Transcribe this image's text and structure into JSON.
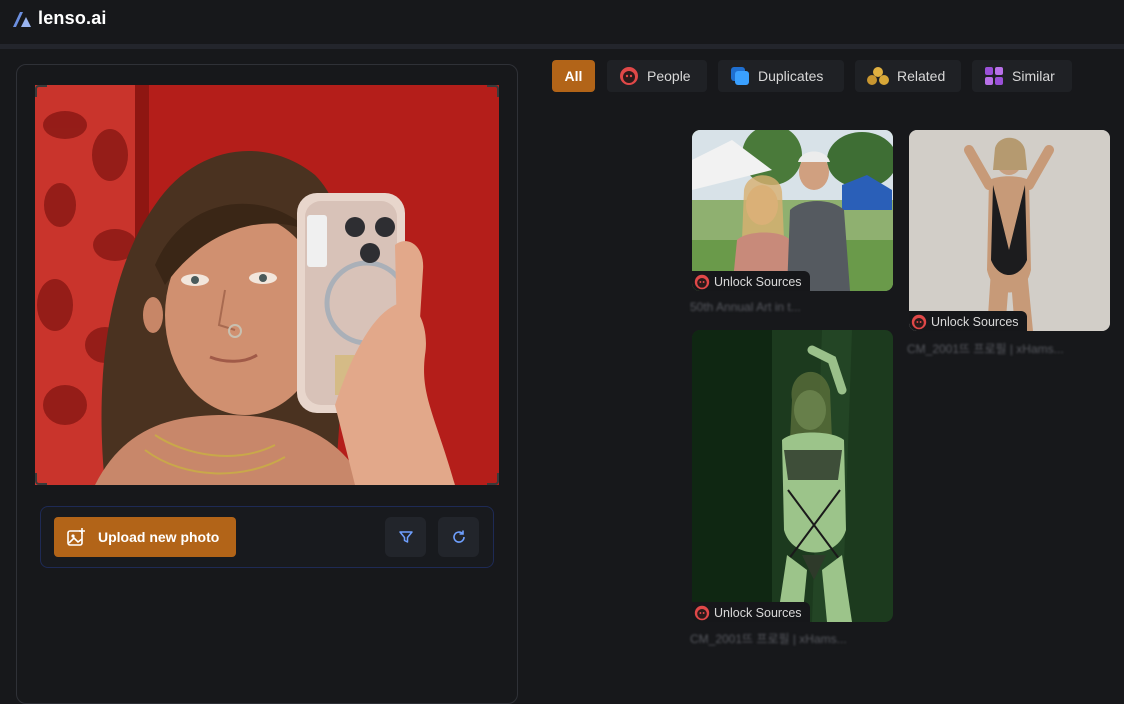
{
  "header": {
    "brand": "lenso.ai"
  },
  "toolbar": {
    "upload_label": "Upload new photo"
  },
  "tabs": [
    {
      "label": "All",
      "icon": "grid-all",
      "active": true
    },
    {
      "label": "People",
      "icon": "face-icon"
    },
    {
      "label": "Duplicates",
      "icon": "copy-icon"
    },
    {
      "label": "Related",
      "icon": "related-icon"
    },
    {
      "label": "Similar",
      "icon": "similar-grid-icon"
    }
  ],
  "results": [
    {
      "badge": "Unlock Sources",
      "caption": "50th Annual Art in t..."
    },
    {
      "badge": "Unlock Sources",
      "caption": "CM_2001뜨 프로필 | xHams..."
    },
    {
      "badge": "Unlock Sources",
      "caption": "CM_2001뜨 프로필 | xHams..."
    }
  ],
  "colors": {
    "accent": "#b26418",
    "background": "#17181b",
    "people": "#e04848",
    "duplicates": "#3aa0ff",
    "related": "#e0b040",
    "similar": "#9a50d8"
  }
}
